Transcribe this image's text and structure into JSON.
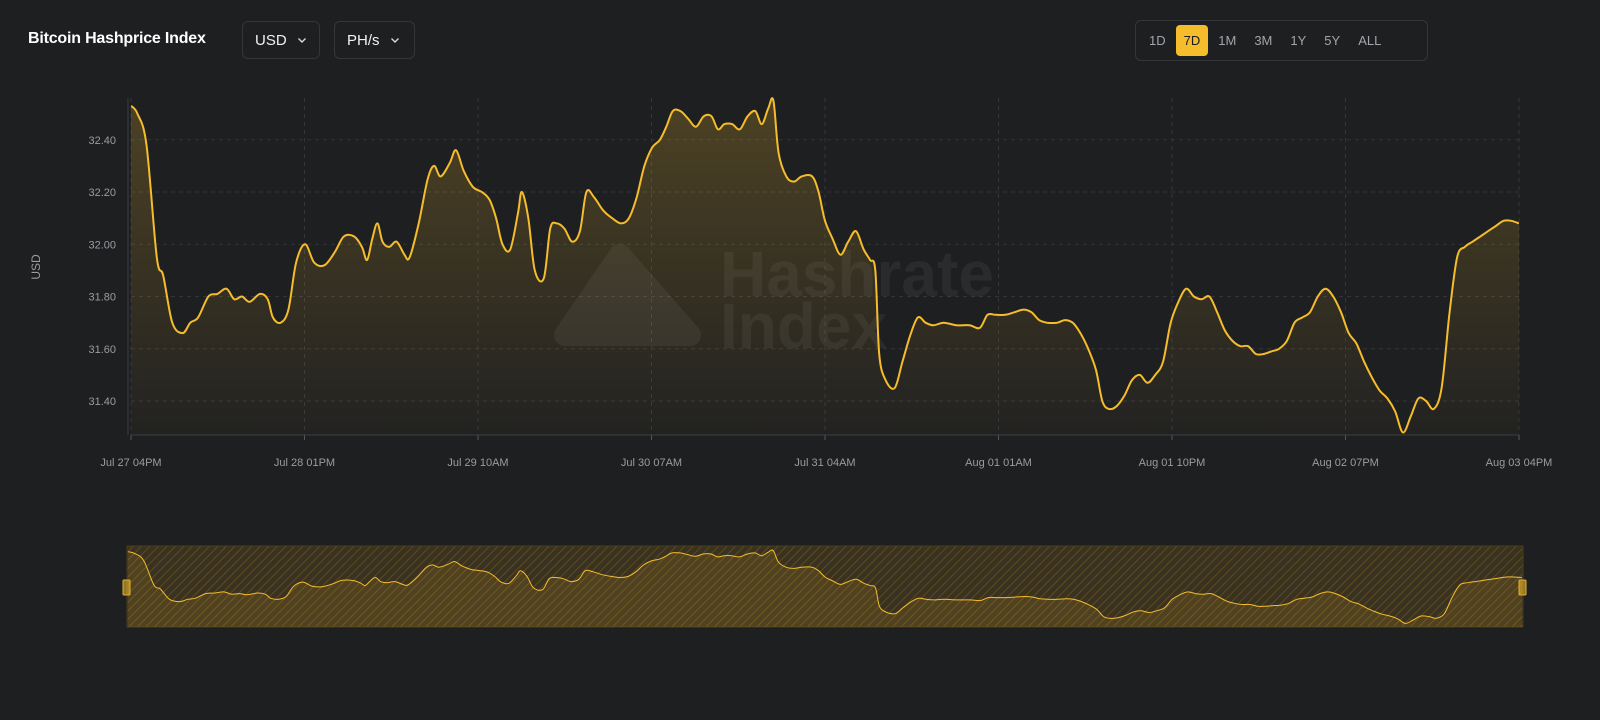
{
  "header": {
    "title": "Bitcoin Hashprice Index",
    "currency_select": "USD",
    "unit_select": "PH/s",
    "ranges": [
      "1D",
      "7D",
      "1M",
      "3M",
      "1Y",
      "5Y",
      "ALL"
    ],
    "active_range": "7D"
  },
  "watermark": "Hashrate Index",
  "colors": {
    "accent": "#f5bd2c",
    "background": "#1e1f21",
    "grid": "#33353a"
  },
  "chart_data": {
    "type": "area",
    "ylabel": "USD",
    "ylim": [
      31.27,
      32.56
    ],
    "yticks": [
      "32.40",
      "32.20",
      "32.00",
      "31.80",
      "31.60",
      "31.40"
    ],
    "xticks": [
      "Jul 27 04PM",
      "Jul 28 01PM",
      "Jul 29 10AM",
      "Jul 30 07AM",
      "Jul 31 04AM",
      "Aug 01 01AM",
      "Aug 01 10PM",
      "Aug 02 07PM",
      "Aug 03 04PM"
    ],
    "x_hours": [
      0,
      168
    ],
    "grid": true,
    "series": [
      {
        "values": [
          [
            0,
            32.53
          ],
          [
            0.5,
            32.5
          ],
          [
            1.2,
            32.38
          ],
          [
            2.0,
            31.95
          ],
          [
            2.5,
            31.88
          ],
          [
            3.2,
            31.7
          ],
          [
            4.0,
            31.66
          ],
          [
            4.6,
            31.7
          ],
          [
            5.2,
            31.72
          ],
          [
            6.0,
            31.8
          ],
          [
            6.7,
            31.81
          ],
          [
            7.4,
            31.83
          ],
          [
            8.0,
            31.79
          ],
          [
            8.6,
            31.8
          ],
          [
            9.2,
            31.78
          ],
          [
            10.0,
            31.81
          ],
          [
            10.6,
            31.79
          ],
          [
            11.0,
            31.72
          ],
          [
            11.6,
            31.7
          ],
          [
            12.2,
            31.75
          ],
          [
            12.8,
            31.93
          ],
          [
            13.5,
            32.0
          ],
          [
            14.2,
            31.93
          ],
          [
            15.0,
            31.92
          ],
          [
            15.8,
            31.97
          ],
          [
            16.5,
            32.03
          ],
          [
            17.3,
            32.03
          ],
          [
            17.9,
            31.99
          ],
          [
            18.3,
            31.94
          ],
          [
            18.7,
            32.02
          ],
          [
            19.1,
            32.08
          ],
          [
            19.5,
            32.01
          ],
          [
            20.0,
            31.99
          ],
          [
            20.6,
            32.01
          ],
          [
            21.2,
            31.96
          ],
          [
            21.6,
            31.95
          ],
          [
            22.3,
            32.08
          ],
          [
            23.0,
            32.25
          ],
          [
            23.5,
            32.3
          ],
          [
            24.0,
            32.26
          ],
          [
            24.7,
            32.31
          ],
          [
            25.2,
            32.36
          ],
          [
            25.8,
            32.28
          ],
          [
            26.5,
            32.22
          ],
          [
            27.2,
            32.2
          ],
          [
            27.8,
            32.17
          ],
          [
            28.3,
            32.1
          ],
          [
            28.8,
            32.0
          ],
          [
            29.4,
            31.98
          ],
          [
            30.0,
            32.12
          ],
          [
            30.3,
            32.2
          ],
          [
            30.8,
            32.1
          ],
          [
            31.3,
            31.9
          ],
          [
            32.0,
            31.87
          ],
          [
            32.5,
            32.06
          ],
          [
            33.0,
            32.08
          ],
          [
            33.6,
            32.06
          ],
          [
            34.2,
            32.01
          ],
          [
            34.8,
            32.05
          ],
          [
            35.3,
            32.2
          ],
          [
            35.9,
            32.18
          ],
          [
            36.6,
            32.13
          ],
          [
            37.3,
            32.1
          ],
          [
            38.0,
            32.08
          ],
          [
            38.6,
            32.1
          ],
          [
            39.2,
            32.18
          ],
          [
            39.8,
            32.3
          ],
          [
            40.4,
            32.37
          ],
          [
            41.0,
            32.4
          ],
          [
            41.5,
            32.45
          ],
          [
            42.0,
            32.51
          ],
          [
            42.6,
            32.51
          ],
          [
            43.2,
            32.48
          ],
          [
            43.8,
            32.45
          ],
          [
            44.4,
            32.49
          ],
          [
            45.0,
            32.49
          ],
          [
            45.5,
            32.44
          ],
          [
            46.0,
            32.46
          ],
          [
            46.6,
            32.46
          ],
          [
            47.2,
            32.44
          ],
          [
            47.8,
            32.49
          ],
          [
            48.4,
            32.51
          ],
          [
            48.9,
            32.46
          ],
          [
            49.4,
            32.52
          ],
          [
            49.8,
            32.55
          ],
          [
            50.2,
            32.35
          ],
          [
            50.8,
            32.26
          ],
          [
            51.4,
            32.24
          ],
          [
            52.0,
            32.26
          ],
          [
            52.8,
            32.26
          ],
          [
            53.3,
            32.2
          ],
          [
            53.8,
            32.09
          ],
          [
            54.4,
            32.02
          ],
          [
            55.0,
            31.96
          ],
          [
            55.6,
            32.01
          ],
          [
            56.2,
            32.05
          ],
          [
            56.8,
            31.98
          ],
          [
            57.3,
            31.94
          ],
          [
            57.7,
            31.9
          ],
          [
            58.0,
            31.58
          ],
          [
            58.5,
            31.48
          ],
          [
            59.2,
            31.45
          ],
          [
            59.8,
            31.55
          ],
          [
            60.4,
            31.65
          ],
          [
            61.0,
            31.72
          ],
          [
            61.6,
            31.7
          ],
          [
            62.2,
            31.69
          ],
          [
            63.0,
            31.7
          ],
          [
            64.0,
            31.69
          ],
          [
            65.0,
            31.69
          ],
          [
            65.8,
            31.68
          ],
          [
            66.4,
            31.73
          ],
          [
            67.0,
            31.73
          ],
          [
            67.8,
            31.73
          ],
          [
            68.5,
            31.74
          ],
          [
            69.2,
            31.75
          ],
          [
            69.8,
            31.74
          ],
          [
            70.4,
            31.71
          ],
          [
            71.0,
            31.7
          ],
          [
            71.8,
            31.7
          ],
          [
            72.4,
            31.71
          ],
          [
            73.0,
            31.7
          ],
          [
            73.6,
            31.66
          ],
          [
            74.2,
            31.6
          ],
          [
            74.8,
            31.52
          ],
          [
            75.3,
            31.4
          ],
          [
            75.8,
            31.37
          ],
          [
            76.4,
            31.38
          ],
          [
            77.0,
            31.42
          ],
          [
            77.6,
            31.48
          ],
          [
            78.2,
            31.5
          ],
          [
            78.8,
            31.47
          ],
          [
            79.4,
            31.5
          ],
          [
            80.0,
            31.55
          ],
          [
            80.6,
            31.7
          ],
          [
            81.2,
            31.78
          ],
          [
            81.8,
            31.83
          ],
          [
            82.4,
            31.8
          ],
          [
            83.0,
            31.79
          ],
          [
            83.6,
            31.8
          ],
          [
            84.2,
            31.74
          ],
          [
            84.8,
            31.67
          ],
          [
            85.4,
            31.63
          ],
          [
            86.0,
            31.61
          ],
          [
            86.6,
            31.61
          ],
          [
            87.2,
            31.58
          ],
          [
            87.8,
            31.58
          ],
          [
            88.4,
            31.59
          ],
          [
            89.0,
            31.6
          ],
          [
            89.6,
            31.63
          ],
          [
            90.2,
            31.7
          ],
          [
            90.8,
            31.72
          ],
          [
            91.4,
            31.74
          ],
          [
            92.0,
            31.8
          ],
          [
            92.6,
            31.83
          ],
          [
            93.2,
            31.8
          ],
          [
            93.8,
            31.74
          ],
          [
            94.4,
            31.66
          ],
          [
            95.0,
            31.62
          ],
          [
            95.6,
            31.55
          ],
          [
            96.2,
            31.49
          ],
          [
            96.8,
            31.44
          ],
          [
            97.4,
            31.41
          ],
          [
            98.0,
            31.36
          ],
          [
            98.6,
            31.28
          ],
          [
            99.2,
            31.34
          ],
          [
            99.8,
            31.41
          ],
          [
            100.4,
            31.4
          ],
          [
            101.0,
            31.37
          ],
          [
            101.6,
            31.45
          ],
          [
            102.2,
            31.73
          ],
          [
            102.8,
            31.95
          ],
          [
            103.4,
            31.99
          ],
          [
            104.0,
            32.01
          ],
          [
            104.6,
            32.03
          ],
          [
            105.2,
            32.05
          ],
          [
            105.8,
            32.07
          ],
          [
            106.4,
            32.09
          ],
          [
            107.0,
            32.09
          ],
          [
            107.6,
            32.08
          ],
          [
            168,
            32.08
          ]
        ]
      }
    ]
  }
}
